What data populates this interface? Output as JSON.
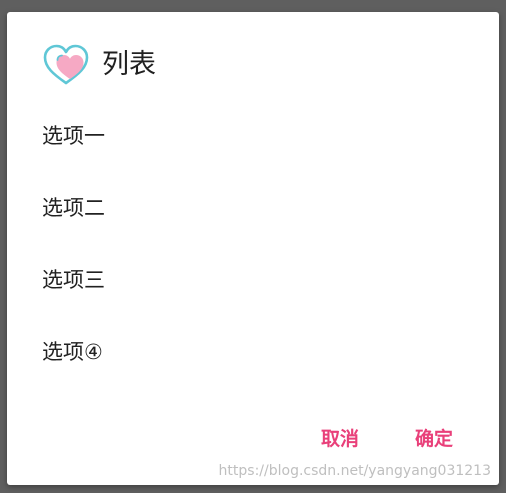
{
  "dialog": {
    "icon": "heart-icon",
    "title": "列表",
    "items": [
      {
        "label": "选项一"
      },
      {
        "label": "选项二"
      },
      {
        "label": "选项三"
      },
      {
        "label": "选项④"
      }
    ],
    "cancel_label": "取消",
    "confirm_label": "确定"
  },
  "watermark": "https://blog.csdn.net/yangyang031213",
  "colors": {
    "accent": "#e9407a",
    "icon_outline": "#5fc7d6",
    "icon_fill": "#f6a9c4",
    "overlay": "#5f5f5f",
    "dialog_background": "#ffffff",
    "text": "#212121"
  }
}
